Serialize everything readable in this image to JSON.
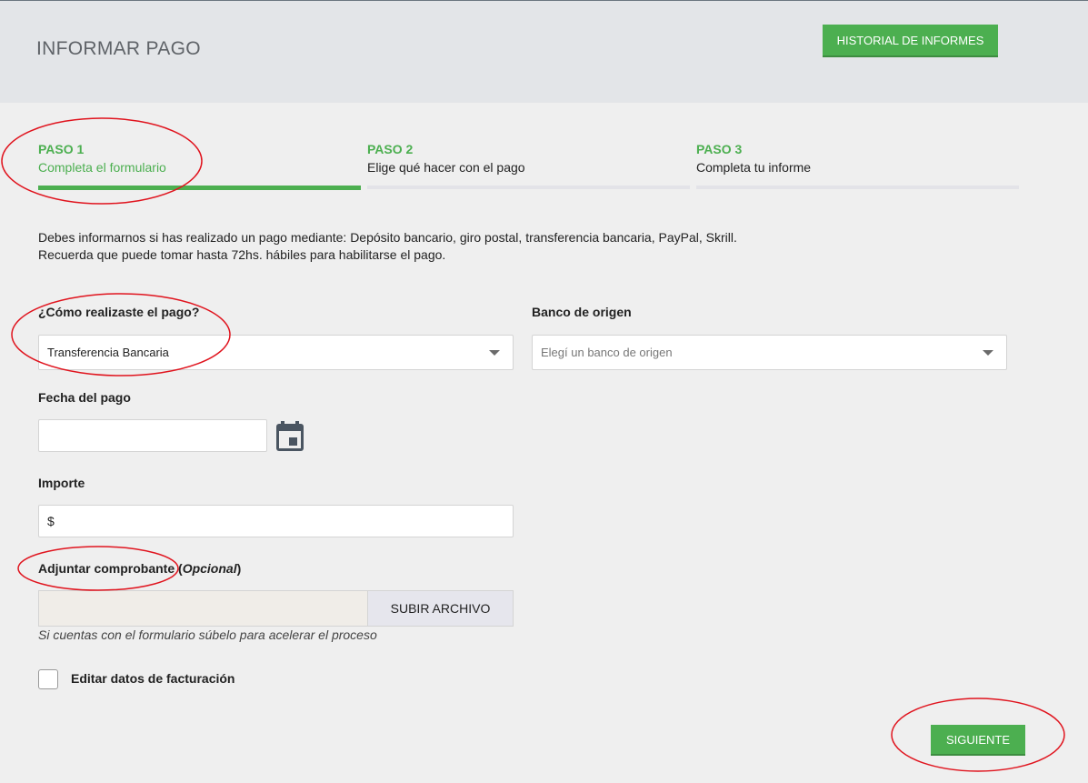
{
  "header": {
    "title": "INFORMAR PAGO",
    "history_button": "HISTORIAL DE INFORMES"
  },
  "steps": [
    {
      "number": "PASO 1",
      "description": "Completa el formulario",
      "active": true
    },
    {
      "number": "PASO 2",
      "description": "Elige qué hacer con el pago",
      "active": false
    },
    {
      "number": "PASO 3",
      "description": "Completa tu informe",
      "active": false
    }
  ],
  "intro": {
    "line1": "Debes informarnos si has realizado un pago mediante: Depósito bancario, giro postal, transferencia bancaria, PayPal, Skrill.",
    "line2": "Recuerda que puede tomar hasta 72hs. hábiles para habilitarse el pago."
  },
  "form": {
    "payment_method": {
      "label": "¿Cómo realizaste el pago?",
      "value": "Transferencia Bancaria"
    },
    "origin_bank": {
      "label": "Banco de origen",
      "placeholder": "Elegí un banco de origen"
    },
    "payment_date": {
      "label": "Fecha del pago",
      "value": ""
    },
    "amount": {
      "label": "Importe",
      "prefix": "$",
      "value": ""
    },
    "attachment": {
      "label": "Adjuntar comprobante",
      "label_open_paren": "(",
      "optional": "Opcional",
      "label_close_paren": ")",
      "upload_button": "SUBIR ARCHIVO",
      "hint": "Si cuentas con el formulario súbelo para acelerar el proceso"
    },
    "billing_checkbox": {
      "label": "Editar datos de facturación",
      "checked": false
    }
  },
  "next_button": "SIGUIENTE",
  "colors": {
    "accent_green": "#4caf50",
    "header_bg": "#e3e5e8",
    "annotation_red": "#e0141e"
  },
  "icons": {
    "calendar": "calendar-icon",
    "dropdown": "chevron-down-icon"
  }
}
